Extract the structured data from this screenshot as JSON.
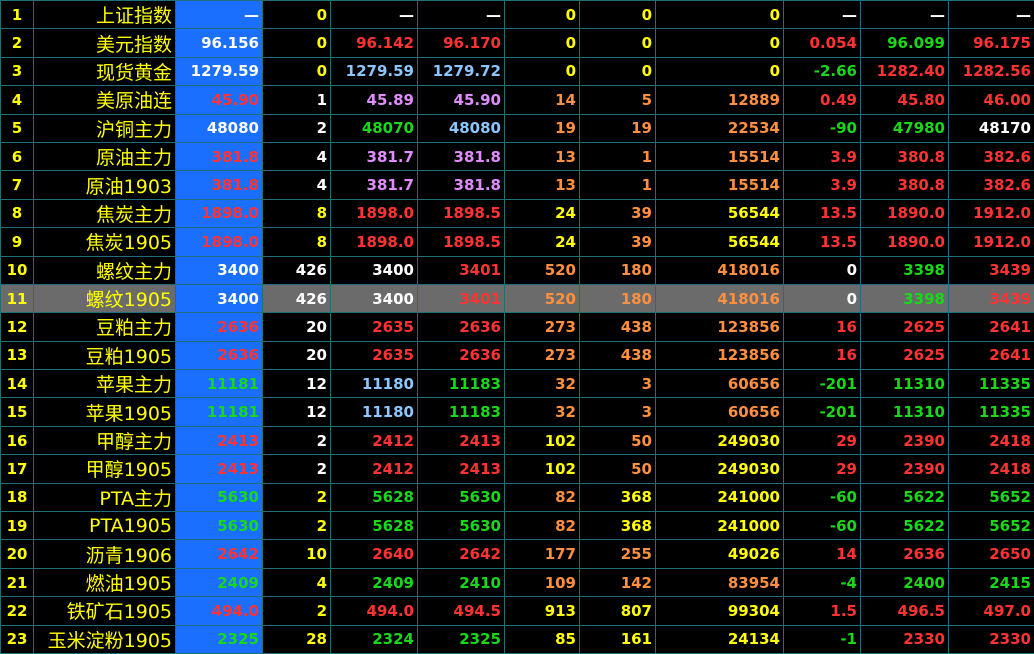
{
  "colors": {
    "background": "#000000",
    "grid_line": "#1f6f7a",
    "highlight_cell": "#1a6fff",
    "selected_row": "#6b6b6b",
    "up_red": "#ff3333",
    "down_green": "#19d819",
    "yellow": "#ffff00",
    "white": "#ffffff",
    "blue_light": "#8cc6ff",
    "violet": "#e08cff",
    "orange": "#ff9040"
  },
  "selected_row_index": 10,
  "rows": [
    {
      "idx": "1",
      "name": "上证指数",
      "last": "—",
      "vol": "0",
      "bid": "—",
      "ask": "—",
      "bidq": "0",
      "askq": "0",
      "oi": "0",
      "chg": "—",
      "low": "—",
      "high": "—",
      "colors": {
        "last": "#ffffff",
        "vol": "#ffff00",
        "bid": "#ffffff",
        "ask": "#ffffff",
        "bidq": "#ffff00",
        "askq": "#ffff00",
        "oi": "#ffff00",
        "chg": "#ffffff",
        "low": "#ffffff",
        "high": "#ffffff"
      }
    },
    {
      "idx": "2",
      "name": "美元指数",
      "last": "96.156",
      "vol": "0",
      "bid": "96.142",
      "ask": "96.170",
      "bidq": "0",
      "askq": "0",
      "oi": "0",
      "chg": "0.054",
      "low": "96.099",
      "high": "96.175",
      "colors": {
        "last": "#ffffff",
        "vol": "#ffff00",
        "bid": "#ff3333",
        "ask": "#ff3333",
        "bidq": "#ffff00",
        "askq": "#ffff00",
        "oi": "#ffff00",
        "chg": "#ff3333",
        "low": "#19d819",
        "high": "#ff3333"
      }
    },
    {
      "idx": "3",
      "name": "现货黄金",
      "last": "1279.59",
      "vol": "0",
      "bid": "1279.59",
      "ask": "1279.72",
      "bidq": "0",
      "askq": "0",
      "oi": "0",
      "chg": "-2.66",
      "low": "1282.40",
      "high": "1282.56",
      "colors": {
        "last": "#ffffff",
        "vol": "#ffff00",
        "bid": "#8cc6ff",
        "ask": "#8cc6ff",
        "bidq": "#ffff00",
        "askq": "#ffff00",
        "oi": "#ffff00",
        "chg": "#19d819",
        "low": "#ff3333",
        "high": "#ff3333"
      }
    },
    {
      "idx": "4",
      "name": "美原油连",
      "last": "45.90",
      "vol": "1",
      "bid": "45.89",
      "ask": "45.90",
      "bidq": "14",
      "askq": "5",
      "oi": "12889",
      "chg": "0.49",
      "low": "45.80",
      "high": "46.00",
      "colors": {
        "last": "#ff3333",
        "vol": "#ffffff",
        "bid": "#e08cff",
        "ask": "#e08cff",
        "bidq": "#ff9040",
        "askq": "#ff9040",
        "oi": "#ff9040",
        "chg": "#ff3333",
        "low": "#ff3333",
        "high": "#ff3333"
      }
    },
    {
      "idx": "5",
      "name": "沪铜主力",
      "last": "48080",
      "vol": "2",
      "bid": "48070",
      "ask": "48080",
      "bidq": "19",
      "askq": "19",
      "oi": "22534",
      "chg": "-90",
      "low": "47980",
      "high": "48170",
      "colors": {
        "last": "#ffffff",
        "vol": "#ffffff",
        "bid": "#19d819",
        "ask": "#8cc6ff",
        "bidq": "#ff9040",
        "askq": "#ff9040",
        "oi": "#ff9040",
        "chg": "#19d819",
        "low": "#19d819",
        "high": "#ffffff"
      }
    },
    {
      "idx": "6",
      "name": "原油主力",
      "last": "381.8",
      "vol": "4",
      "bid": "381.7",
      "ask": "381.8",
      "bidq": "13",
      "askq": "1",
      "oi": "15514",
      "chg": "3.9",
      "low": "380.8",
      "high": "382.6",
      "colors": {
        "last": "#ff3333",
        "vol": "#ffffff",
        "bid": "#e08cff",
        "ask": "#e08cff",
        "bidq": "#ff9040",
        "askq": "#ff9040",
        "oi": "#ff9040",
        "chg": "#ff3333",
        "low": "#ff3333",
        "high": "#ff3333"
      }
    },
    {
      "idx": "7",
      "name": "原油1903",
      "last": "381.8",
      "vol": "4",
      "bid": "381.7",
      "ask": "381.8",
      "bidq": "13",
      "askq": "1",
      "oi": "15514",
      "chg": "3.9",
      "low": "380.8",
      "high": "382.6",
      "colors": {
        "last": "#ff3333",
        "vol": "#ffffff",
        "bid": "#e08cff",
        "ask": "#e08cff",
        "bidq": "#ff9040",
        "askq": "#ff9040",
        "oi": "#ff9040",
        "chg": "#ff3333",
        "low": "#ff3333",
        "high": "#ff3333"
      }
    },
    {
      "idx": "8",
      "name": "焦炭主力",
      "last": "1898.0",
      "vol": "8",
      "bid": "1898.0",
      "ask": "1898.5",
      "bidq": "24",
      "askq": "39",
      "oi": "56544",
      "chg": "13.5",
      "low": "1890.0",
      "high": "1912.0",
      "colors": {
        "last": "#ff3333",
        "vol": "#ffff00",
        "bid": "#ff3333",
        "ask": "#ff3333",
        "bidq": "#ffff00",
        "askq": "#ff9040",
        "oi": "#ffff00",
        "chg": "#ff3333",
        "low": "#ff3333",
        "high": "#ff3333"
      }
    },
    {
      "idx": "9",
      "name": "焦炭1905",
      "last": "1898.0",
      "vol": "8",
      "bid": "1898.0",
      "ask": "1898.5",
      "bidq": "24",
      "askq": "39",
      "oi": "56544",
      "chg": "13.5",
      "low": "1890.0",
      "high": "1912.0",
      "colors": {
        "last": "#ff3333",
        "vol": "#ffff00",
        "bid": "#ff3333",
        "ask": "#ff3333",
        "bidq": "#ffff00",
        "askq": "#ff9040",
        "oi": "#ffff00",
        "chg": "#ff3333",
        "low": "#ff3333",
        "high": "#ff3333"
      }
    },
    {
      "idx": "10",
      "name": "螺纹主力",
      "last": "3400",
      "vol": "426",
      "bid": "3400",
      "ask": "3401",
      "bidq": "520",
      "askq": "180",
      "oi": "418016",
      "chg": "0",
      "low": "3398",
      "high": "3439",
      "colors": {
        "last": "#ffffff",
        "vol": "#ffffff",
        "bid": "#ffffff",
        "ask": "#ff3333",
        "bidq": "#ff9040",
        "askq": "#ff9040",
        "oi": "#ff9040",
        "chg": "#ffffff",
        "low": "#19d819",
        "high": "#ff3333"
      }
    },
    {
      "idx": "11",
      "name": "螺纹1905",
      "last": "3400",
      "vol": "426",
      "bid": "3400",
      "ask": "3401",
      "bidq": "520",
      "askq": "180",
      "oi": "418016",
      "chg": "0",
      "low": "3398",
      "high": "3439",
      "colors": {
        "last": "#ffffff",
        "vol": "#ffffff",
        "bid": "#ffffff",
        "ask": "#ff3333",
        "bidq": "#ff9040",
        "askq": "#ff9040",
        "oi": "#ff9040",
        "chg": "#ffffff",
        "low": "#19d819",
        "high": "#ff3333"
      }
    },
    {
      "idx": "12",
      "name": "豆粕主力",
      "last": "2636",
      "vol": "20",
      "bid": "2635",
      "ask": "2636",
      "bidq": "273",
      "askq": "438",
      "oi": "123856",
      "chg": "16",
      "low": "2625",
      "high": "2641",
      "colors": {
        "last": "#ff3333",
        "vol": "#ffffff",
        "bid": "#ff3333",
        "ask": "#ff3333",
        "bidq": "#ff9040",
        "askq": "#ff9040",
        "oi": "#ff9040",
        "chg": "#ff3333",
        "low": "#ff3333",
        "high": "#ff3333"
      }
    },
    {
      "idx": "13",
      "name": "豆粕1905",
      "last": "2636",
      "vol": "20",
      "bid": "2635",
      "ask": "2636",
      "bidq": "273",
      "askq": "438",
      "oi": "123856",
      "chg": "16",
      "low": "2625",
      "high": "2641",
      "colors": {
        "last": "#ff3333",
        "vol": "#ffffff",
        "bid": "#ff3333",
        "ask": "#ff3333",
        "bidq": "#ff9040",
        "askq": "#ff9040",
        "oi": "#ff9040",
        "chg": "#ff3333",
        "low": "#ff3333",
        "high": "#ff3333"
      }
    },
    {
      "idx": "14",
      "name": "苹果主力",
      "last": "11181",
      "vol": "12",
      "bid": "11180",
      "ask": "11183",
      "bidq": "32",
      "askq": "3",
      "oi": "60656",
      "chg": "-201",
      "low": "11310",
      "high": "11335",
      "colors": {
        "last": "#19d819",
        "vol": "#ffffff",
        "bid": "#8cc6ff",
        "ask": "#19d819",
        "bidq": "#ff9040",
        "askq": "#ff9040",
        "oi": "#ff9040",
        "chg": "#19d819",
        "low": "#19d819",
        "high": "#19d819"
      }
    },
    {
      "idx": "15",
      "name": "苹果1905",
      "last": "11181",
      "vol": "12",
      "bid": "11180",
      "ask": "11183",
      "bidq": "32",
      "askq": "3",
      "oi": "60656",
      "chg": "-201",
      "low": "11310",
      "high": "11335",
      "colors": {
        "last": "#19d819",
        "vol": "#ffffff",
        "bid": "#8cc6ff",
        "ask": "#19d819",
        "bidq": "#ff9040",
        "askq": "#ff9040",
        "oi": "#ff9040",
        "chg": "#19d819",
        "low": "#19d819",
        "high": "#19d819"
      }
    },
    {
      "idx": "16",
      "name": "甲醇主力",
      "last": "2413",
      "vol": "2",
      "bid": "2412",
      "ask": "2413",
      "bidq": "102",
      "askq": "50",
      "oi": "249030",
      "chg": "29",
      "low": "2390",
      "high": "2418",
      "colors": {
        "last": "#ff3333",
        "vol": "#ffffff",
        "bid": "#ff3333",
        "ask": "#ff3333",
        "bidq": "#ffff00",
        "askq": "#ff9040",
        "oi": "#ffff00",
        "chg": "#ff3333",
        "low": "#ff3333",
        "high": "#ff3333"
      }
    },
    {
      "idx": "17",
      "name": "甲醇1905",
      "last": "2413",
      "vol": "2",
      "bid": "2412",
      "ask": "2413",
      "bidq": "102",
      "askq": "50",
      "oi": "249030",
      "chg": "29",
      "low": "2390",
      "high": "2418",
      "colors": {
        "last": "#ff3333",
        "vol": "#ffffff",
        "bid": "#ff3333",
        "ask": "#ff3333",
        "bidq": "#ffff00",
        "askq": "#ff9040",
        "oi": "#ffff00",
        "chg": "#ff3333",
        "low": "#ff3333",
        "high": "#ff3333"
      }
    },
    {
      "idx": "18",
      "name": "PTA主力",
      "last": "5630",
      "vol": "2",
      "bid": "5628",
      "ask": "5630",
      "bidq": "82",
      "askq": "368",
      "oi": "241000",
      "chg": "-60",
      "low": "5622",
      "high": "5652",
      "colors": {
        "last": "#19d819",
        "vol": "#ffff00",
        "bid": "#19d819",
        "ask": "#19d819",
        "bidq": "#ff9040",
        "askq": "#ffff00",
        "oi": "#ffff00",
        "chg": "#19d819",
        "low": "#19d819",
        "high": "#19d819"
      }
    },
    {
      "idx": "19",
      "name": "PTA1905",
      "last": "5630",
      "vol": "2",
      "bid": "5628",
      "ask": "5630",
      "bidq": "82",
      "askq": "368",
      "oi": "241000",
      "chg": "-60",
      "low": "5622",
      "high": "5652",
      "colors": {
        "last": "#19d819",
        "vol": "#ffff00",
        "bid": "#19d819",
        "ask": "#19d819",
        "bidq": "#ff9040",
        "askq": "#ffff00",
        "oi": "#ffff00",
        "chg": "#19d819",
        "low": "#19d819",
        "high": "#19d819"
      }
    },
    {
      "idx": "20",
      "name": "沥青1906",
      "last": "2642",
      "vol": "10",
      "bid": "2640",
      "ask": "2642",
      "bidq": "177",
      "askq": "255",
      "oi": "49026",
      "chg": "14",
      "low": "2636",
      "high": "2650",
      "colors": {
        "last": "#ff3333",
        "vol": "#ffff00",
        "bid": "#ff3333",
        "ask": "#ff3333",
        "bidq": "#ff9040",
        "askq": "#ff9040",
        "oi": "#ffff00",
        "chg": "#ff3333",
        "low": "#ff3333",
        "high": "#ff3333"
      }
    },
    {
      "idx": "21",
      "name": "燃油1905",
      "last": "2409",
      "vol": "4",
      "bid": "2409",
      "ask": "2410",
      "bidq": "109",
      "askq": "142",
      "oi": "83954",
      "chg": "-4",
      "low": "2400",
      "high": "2415",
      "colors": {
        "last": "#19d819",
        "vol": "#ffff00",
        "bid": "#19d819",
        "ask": "#19d819",
        "bidq": "#ff9040",
        "askq": "#ff9040",
        "oi": "#ff9040",
        "chg": "#19d819",
        "low": "#19d819",
        "high": "#19d819"
      }
    },
    {
      "idx": "22",
      "name": "铁矿石1905",
      "last": "494.0",
      "vol": "2",
      "bid": "494.0",
      "ask": "494.5",
      "bidq": "913",
      "askq": "807",
      "oi": "99304",
      "chg": "1.5",
      "low": "496.5",
      "high": "497.0",
      "colors": {
        "last": "#ff3333",
        "vol": "#ffff00",
        "bid": "#ff3333",
        "ask": "#ff3333",
        "bidq": "#ffff00",
        "askq": "#ffff00",
        "oi": "#ffff00",
        "chg": "#ff3333",
        "low": "#ff3333",
        "high": "#ff3333"
      }
    },
    {
      "idx": "23",
      "name": "玉米淀粉1905",
      "last": "2325",
      "vol": "28",
      "bid": "2324",
      "ask": "2325",
      "bidq": "85",
      "askq": "161",
      "oi": "24134",
      "chg": "-1",
      "low": "2330",
      "high": "2330",
      "colors": {
        "last": "#19d819",
        "vol": "#ffff00",
        "bid": "#19d819",
        "ask": "#19d819",
        "bidq": "#ffff00",
        "askq": "#ffff00",
        "oi": "#ffff00",
        "chg": "#19d819",
        "low": "#ff3333",
        "high": "#ff3333"
      }
    }
  ]
}
